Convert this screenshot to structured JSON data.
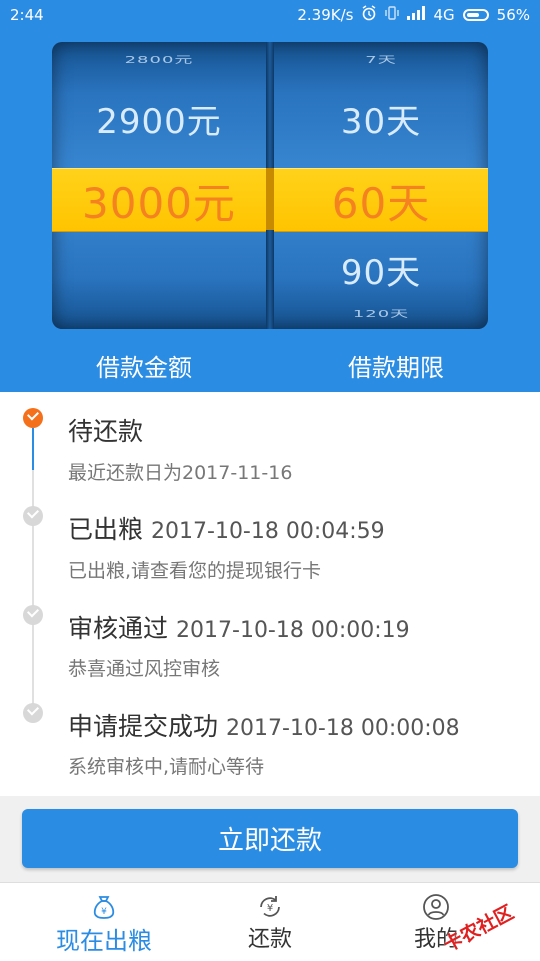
{
  "status_bar": {
    "time": "2:44",
    "net_speed": "2.39K/s",
    "network": "4G",
    "battery": "56%"
  },
  "picker": {
    "amount": {
      "far_top": "2800元",
      "top": "2900元",
      "selected": "3000元",
      "bottom": "",
      "far_bottom": ""
    },
    "term": {
      "far_top": "7天",
      "top": "30天",
      "selected": "60天",
      "bottom": "90天",
      "far_bottom": "120天"
    },
    "labels": {
      "amount": "借款金额",
      "term": "借款期限"
    }
  },
  "timeline": [
    {
      "title": "待还款",
      "time": "",
      "desc": "最近还款日为2017-11-16",
      "active": true
    },
    {
      "title": "已出粮",
      "time": "2017-10-18 00:04:59",
      "desc": "已出粮,请查看您的提现银行卡",
      "active": false
    },
    {
      "title": "审核通过",
      "time": "2017-10-18 00:00:19",
      "desc": "恭喜通过风控审核",
      "active": false
    },
    {
      "title": "申请提交成功",
      "time": "2017-10-18 00:00:08",
      "desc": "系统审核中,请耐心等待",
      "active": false
    }
  ],
  "repay_button": "立即还款",
  "nav": {
    "items": [
      {
        "label": "现在出粮",
        "icon": "money-bag-icon",
        "active": true
      },
      {
        "label": "还款",
        "icon": "repay-cycle-icon",
        "active": false
      },
      {
        "label": "我的",
        "icon": "user-icon",
        "active": false
      }
    ]
  },
  "watermark": "卡农社区",
  "colors": {
    "primary": "#2b8ce3",
    "accent_orange": "#f5701a",
    "selection_yellow": "#ffc400"
  }
}
